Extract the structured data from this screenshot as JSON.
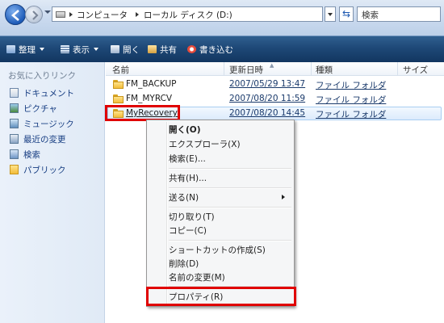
{
  "address_bar": {
    "breadcrumbs": [
      "コンピュータ",
      "ローカル ディスク (D:)"
    ],
    "search_placeholder": "検索"
  },
  "command_bar": {
    "items": [
      {
        "label": "整理",
        "icon": "organize-icon",
        "has_dropdown": true
      },
      {
        "label": "表示",
        "icon": "views-icon",
        "has_dropdown": true
      },
      {
        "label": "開く",
        "icon": "open-icon",
        "has_dropdown": false
      },
      {
        "label": "共有",
        "icon": "share-icon",
        "has_dropdown": false
      },
      {
        "label": "書き込む",
        "icon": "burn-icon",
        "has_dropdown": false
      }
    ]
  },
  "favorites": {
    "title": "お気に入りリンク",
    "items": [
      {
        "label": "ドキュメント",
        "icon": "documents-icon"
      },
      {
        "label": "ピクチャ",
        "icon": "pictures-icon"
      },
      {
        "label": "ミュージック",
        "icon": "music-icon"
      },
      {
        "label": "最近の変更",
        "icon": "recent-changes-icon"
      },
      {
        "label": "検索",
        "icon": "searches-icon"
      },
      {
        "label": "パブリック",
        "icon": "public-folder-icon"
      }
    ]
  },
  "file_list": {
    "columns": [
      "名前",
      "更新日時",
      "種類",
      "サイズ"
    ],
    "rows": [
      {
        "name": "FM_BACKUP",
        "date": "2007/05/29 13:47",
        "type": "ファイル フォルダ",
        "selected": false
      },
      {
        "name": "FM_MYRCV",
        "date": "2007/08/20 11:59",
        "type": "ファイル フォルダ",
        "selected": false
      },
      {
        "name": "MyRecovery",
        "date": "2007/08/20 14:45",
        "type": "ファイル フォルダ",
        "selected": true
      }
    ]
  },
  "context_menu": {
    "items": [
      {
        "label": "開く(O)",
        "bold": true
      },
      {
        "label": "エクスプローラ(X)"
      },
      {
        "label": "検索(E)..."
      },
      {
        "separator": true
      },
      {
        "label": "共有(H)..."
      },
      {
        "separator": true
      },
      {
        "label": "送る(N)",
        "submenu": true
      },
      {
        "separator": true
      },
      {
        "label": "切り取り(T)"
      },
      {
        "label": "コピー(C)"
      },
      {
        "separator": true
      },
      {
        "label": "ショートカットの作成(S)"
      },
      {
        "label": "削除(D)"
      },
      {
        "label": "名前の変更(M)"
      },
      {
        "separator": true
      },
      {
        "label": "プロパティ(R)"
      }
    ]
  },
  "colors": {
    "highlight_box": "#e00000",
    "command_bar": "#1e4877",
    "link_text": "#163d82"
  }
}
